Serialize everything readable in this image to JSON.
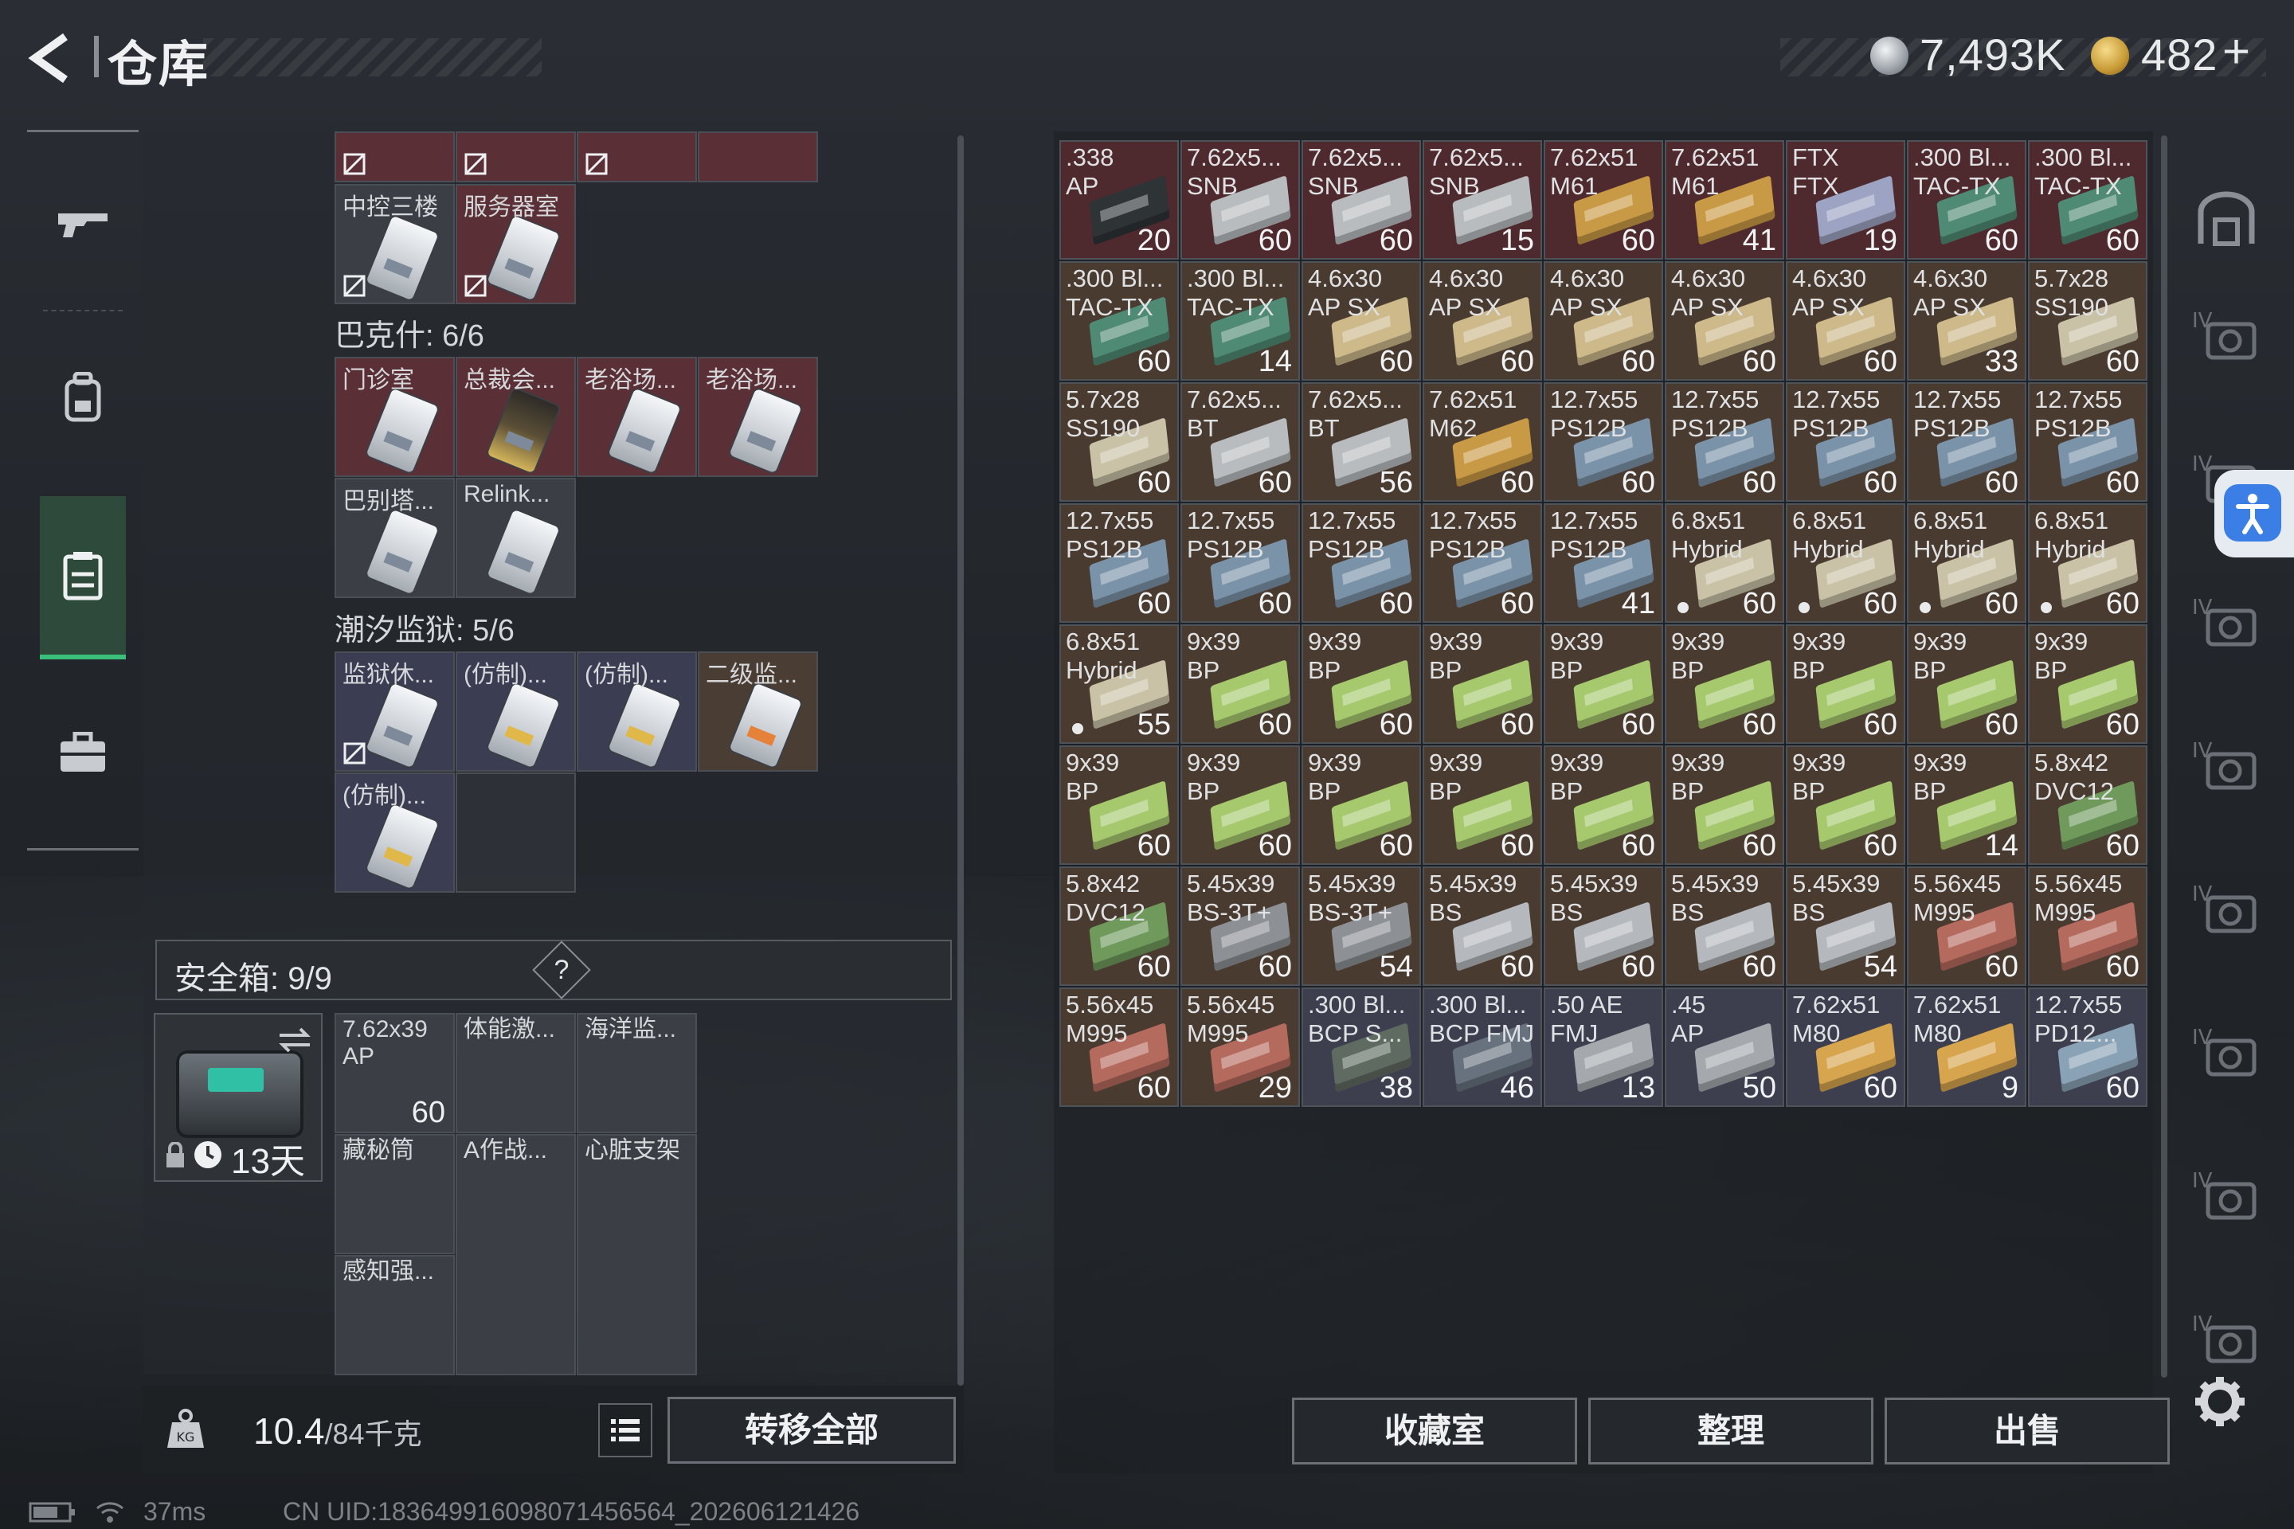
{
  "header": {
    "title": "仓库",
    "currency_silver": "7,493K",
    "currency_gold": "482",
    "currency_gold_suffix": "+"
  },
  "stash": {
    "top_row": [
      {
        "label": "",
        "color": "red"
      },
      {
        "label": "",
        "color": "red"
      },
      {
        "label": "",
        "color": "red"
      },
      {
        "label": "",
        "color": "red"
      }
    ],
    "group1_items": [
      {
        "label": "中控三楼",
        "color": "gray",
        "card": "",
        "no": true
      },
      {
        "label": "服务器室",
        "color": "red",
        "card": "",
        "no": true
      }
    ],
    "section_bakesh": "巴克什: 6/6",
    "bakesh_items": [
      {
        "label": "门诊室",
        "color": "red",
        "card": ""
      },
      {
        "label": "总裁会...",
        "color": "red",
        "card": "gold"
      },
      {
        "label": "老浴场...",
        "color": "red",
        "card": ""
      },
      {
        "label": "老浴场...",
        "color": "red",
        "card": ""
      },
      {
        "label": "巴别塔...",
        "color": "gray",
        "card": ""
      },
      {
        "label": "Relink...",
        "color": "gray",
        "card": ""
      }
    ],
    "section_tidal": "潮汐监狱: 5/6",
    "tidal_items": [
      {
        "label": "监狱休...",
        "color": "blue",
        "card": "",
        "no": true
      },
      {
        "label": "(仿制)...",
        "color": "blue",
        "card": "yellow"
      },
      {
        "label": "(仿制)...",
        "color": "blue",
        "card": "yellow"
      },
      {
        "label": "二级监...",
        "color": "brown",
        "card": "orange"
      },
      {
        "label": "(仿制)...",
        "color": "blue",
        "card": "yellow"
      }
    ],
    "safebox_label": "安全箱: 9/9",
    "safebox_help": "?",
    "safebox_days": "13天",
    "safebox_items": [
      {
        "label": "7.62x39\nAP",
        "count": "60"
      },
      {
        "label": "体能激...",
        "count": ""
      },
      {
        "label": "海洋监...",
        "count": ""
      },
      {
        "label": "藏秘筒",
        "count": ""
      },
      {
        "label": "A作战...",
        "count": ""
      },
      {
        "label": "心脏支架",
        "count": ""
      },
      {
        "label": "感知强...",
        "count": ""
      }
    ],
    "weight_value": "10.4",
    "weight_max": "/84千克",
    "transfer_all": "转移全部"
  },
  "status_bar": {
    "ping": "37ms",
    "uid": "CN UID:18364991609807145656​4_202606121426"
  },
  "ammo": [
    {
      "label": ".338\nAP",
      "count": "20",
      "box": "#2e3336",
      "bg": "#4e2a2f"
    },
    {
      "label": "7.62x5...\nSNB",
      "count": "60",
      "box": "#b8bcbf",
      "bg": "#4e2a2f"
    },
    {
      "label": "7.62x5...\nSNB",
      "count": "60",
      "box": "#b8bcbf",
      "bg": "#4e2a2f"
    },
    {
      "label": "7.62x5...\nSNB",
      "count": "15",
      "box": "#b8bcbf",
      "bg": "#4e2a2f"
    },
    {
      "label": "7.62x51\nM61",
      "count": "60",
      "box": "#c99a45",
      "bg": "#4e2a2f"
    },
    {
      "label": "7.62x51\nM61",
      "count": "41",
      "box": "#c99a45",
      "bg": "#4e2a2f"
    },
    {
      "label": "FTX\nFTX",
      "count": "19",
      "box": "#9da3c2",
      "bg": "#4e2a2f"
    },
    {
      "label": ".300 Bl...\nTAC-TX",
      "count": "60",
      "box": "#4f8a74",
      "bg": "#4e2a2f"
    },
    {
      "label": ".300 Bl...\nTAC-TX",
      "count": "60",
      "box": "#4f8a74",
      "bg": "#4e2a2f"
    },
    {
      "label": ".300 Bl...\nTAC-TX",
      "count": "60",
      "box": "#4f8a74",
      "bg": "#4a3b31"
    },
    {
      "label": ".300 Bl...\nTAC-TX",
      "count": "14",
      "box": "#4f8a74",
      "bg": "#4a3b31"
    },
    {
      "label": "4.6x30\nAP SX",
      "count": "60",
      "box": "#cdb98a",
      "bg": "#4a3b31"
    },
    {
      "label": "4.6x30\nAP SX",
      "count": "60",
      "box": "#cdb98a",
      "bg": "#4a3b31"
    },
    {
      "label": "4.6x30\nAP SX",
      "count": "60",
      "box": "#cdb98a",
      "bg": "#4a3b31"
    },
    {
      "label": "4.6x30\nAP SX",
      "count": "60",
      "box": "#cdb98a",
      "bg": "#4a3b31"
    },
    {
      "label": "4.6x30\nAP SX",
      "count": "60",
      "box": "#cdb98a",
      "bg": "#4a3b31"
    },
    {
      "label": "4.6x30\nAP SX",
      "count": "33",
      "box": "#cdb98a",
      "bg": "#4a3b31"
    },
    {
      "label": "5.7x28\nSS190",
      "count": "60",
      "box": "#c9c2a6",
      "bg": "#4a3b31"
    },
    {
      "label": "5.7x28\nSS190",
      "count": "60",
      "box": "#c9c2a6",
      "bg": "#4a3b31"
    },
    {
      "label": "7.62x5...\nBT",
      "count": "60",
      "box": "#b8bcbf",
      "bg": "#4a3b31"
    },
    {
      "label": "7.62x5...\nBT",
      "count": "56",
      "box": "#b8bcbf",
      "bg": "#4a3b31"
    },
    {
      "label": "7.62x51\nM62",
      "count": "60",
      "box": "#c99a45",
      "bg": "#4a3b31"
    },
    {
      "label": "12.7x55\nPS12B",
      "count": "60",
      "box": "#7b93a8",
      "bg": "#4a3b31"
    },
    {
      "label": "12.7x55\nPS12B",
      "count": "60",
      "box": "#7b93a8",
      "bg": "#4a3b31"
    },
    {
      "label": "12.7x55\nPS12B",
      "count": "60",
      "box": "#7b93a8",
      "bg": "#4a3b31"
    },
    {
      "label": "12.7x55\nPS12B",
      "count": "60",
      "box": "#7b93a8",
      "bg": "#4a3b31"
    },
    {
      "label": "12.7x55\nPS12B",
      "count": "60",
      "box": "#7b93a8",
      "bg": "#4a3b31"
    },
    {
      "label": "12.7x55\nPS12B",
      "count": "60",
      "box": "#7b93a8",
      "bg": "#4a3b31"
    },
    {
      "label": "12.7x55\nPS12B",
      "count": "60",
      "box": "#7b93a8",
      "bg": "#4a3b31"
    },
    {
      "label": "12.7x55\nPS12B",
      "count": "60",
      "box": "#7b93a8",
      "bg": "#4a3b31"
    },
    {
      "label": "12.7x55\nPS12B",
      "count": "60",
      "box": "#7b93a8",
      "bg": "#4a3b31"
    },
    {
      "label": "12.7x55\nPS12B",
      "count": "41",
      "box": "#7b93a8",
      "bg": "#4a3b31"
    },
    {
      "label": "6.8x51\nHybrid",
      "count": "60",
      "box": "#c9c2a6",
      "bg": "#4a3b31",
      "dot": true
    },
    {
      "label": "6.8x51\nHybrid",
      "count": "60",
      "box": "#c9c2a6",
      "bg": "#4a3b31",
      "dot": true
    },
    {
      "label": "6.8x51\nHybrid",
      "count": "60",
      "box": "#c9c2a6",
      "bg": "#4a3b31",
      "dot": true
    },
    {
      "label": "6.8x51\nHybrid",
      "count": "60",
      "box": "#c9c2a6",
      "bg": "#4a3b31",
      "dot": true
    },
    {
      "label": "6.8x51\nHybrid",
      "count": "55",
      "box": "#c9c2a6",
      "bg": "#4a3b31",
      "dot": true
    },
    {
      "label": "9x39\nBP",
      "count": "60",
      "box": "#a7c96e",
      "bg": "#4a3b31"
    },
    {
      "label": "9x39\nBP",
      "count": "60",
      "box": "#a7c96e",
      "bg": "#4a3b31"
    },
    {
      "label": "9x39\nBP",
      "count": "60",
      "box": "#a7c96e",
      "bg": "#4a3b31"
    },
    {
      "label": "9x39\nBP",
      "count": "60",
      "box": "#a7c96e",
      "bg": "#4a3b31"
    },
    {
      "label": "9x39\nBP",
      "count": "60",
      "box": "#a7c96e",
      "bg": "#4a3b31"
    },
    {
      "label": "9x39\nBP",
      "count": "60",
      "box": "#a7c96e",
      "bg": "#4a3b31"
    },
    {
      "label": "9x39\nBP",
      "count": "60",
      "box": "#a7c96e",
      "bg": "#4a3b31"
    },
    {
      "label": "9x39\nBP",
      "count": "60",
      "box": "#a7c96e",
      "bg": "#4a3b31"
    },
    {
      "label": "9x39\nBP",
      "count": "60",
      "box": "#a7c96e",
      "bg": "#4a3b31"
    },
    {
      "label": "9x39\nBP",
      "count": "60",
      "box": "#a7c96e",
      "bg": "#4a3b31"
    },
    {
      "label": "9x39\nBP",
      "count": "60",
      "box": "#a7c96e",
      "bg": "#4a3b31"
    },
    {
      "label": "9x39\nBP",
      "count": "60",
      "box": "#a7c96e",
      "bg": "#4a3b31"
    },
    {
      "label": "9x39\nBP",
      "count": "60",
      "box": "#a7c96e",
      "bg": "#4a3b31"
    },
    {
      "label": "9x39\nBP",
      "count": "60",
      "box": "#a7c96e",
      "bg": "#4a3b31"
    },
    {
      "label": "9x39\nBP",
      "count": "60",
      "box": "#a7c96e",
      "bg": "#4a3b31"
    },
    {
      "label": "9x39\nBP",
      "count": "14",
      "box": "#a7c96e",
      "bg": "#4a3b31"
    },
    {
      "label": "5.8x42\nDVC12",
      "count": "60",
      "box": "#6f9a5c",
      "bg": "#4a3b31"
    },
    {
      "label": "5.8x42\nDVC12",
      "count": "60",
      "box": "#6f9a5c",
      "bg": "#4a3b31"
    },
    {
      "label": "5.45x39\nBS-3T+",
      "count": "60",
      "box": "#8d9094",
      "bg": "#4a3b31"
    },
    {
      "label": "5.45x39\nBS-3T+",
      "count": "54",
      "box": "#8d9094",
      "bg": "#4a3b31"
    },
    {
      "label": "5.45x39\nBS",
      "count": "60",
      "box": "#b5b9bd",
      "bg": "#4a3b31"
    },
    {
      "label": "5.45x39\nBS",
      "count": "60",
      "box": "#b5b9bd",
      "bg": "#4a3b31"
    },
    {
      "label": "5.45x39\nBS",
      "count": "60",
      "box": "#b5b9bd",
      "bg": "#4a3b31"
    },
    {
      "label": "5.45x39\nBS",
      "count": "54",
      "box": "#b5b9bd",
      "bg": "#4a3b31"
    },
    {
      "label": "5.56x45\nM995",
      "count": "60",
      "box": "#b56a5e",
      "bg": "#4a3b31"
    },
    {
      "label": "5.56x45\nM995",
      "count": "60",
      "box": "#b56a5e",
      "bg": "#4a3b31"
    },
    {
      "label": "5.56x45\nM995",
      "count": "60",
      "box": "#b56a5e",
      "bg": "#4a3b31"
    },
    {
      "label": "5.56x45\nM995",
      "count": "29",
      "box": "#b56a5e",
      "bg": "#4a3b31"
    },
    {
      "label": ".300 Bl...\nBCP S...",
      "count": "38",
      "box": "#5f6a61",
      "bg": "#3d3f4f"
    },
    {
      "label": ".300 Bl...\nBCP FMJ",
      "count": "46",
      "box": "#67727e",
      "bg": "#3d3f4f"
    },
    {
      "label": ".50 AE\nFMJ",
      "count": "13",
      "box": "#a5a9ad",
      "bg": "#3d3f4f"
    },
    {
      "label": ".45\nAP",
      "count": "50",
      "box": "#a5a9ad",
      "bg": "#3d3f4f"
    },
    {
      "label": "7.62x51\nM80",
      "count": "60",
      "box": "#d6a54e",
      "bg": "#3d3f4f"
    },
    {
      "label": "7.62x51\nM80",
      "count": "9",
      "box": "#d6a54e",
      "bg": "#3d3f4f"
    },
    {
      "label": "12.7x55\nPD12...",
      "count": "60",
      "box": "#8aa2b5",
      "bg": "#3d3f4f"
    }
  ],
  "actions": {
    "collection": "收藏室",
    "sort": "整理",
    "sell": "出售"
  },
  "right_tabs": [
    "IV",
    "IV",
    "IV",
    "IV",
    "IV",
    "IV",
    "IV",
    "IV"
  ]
}
